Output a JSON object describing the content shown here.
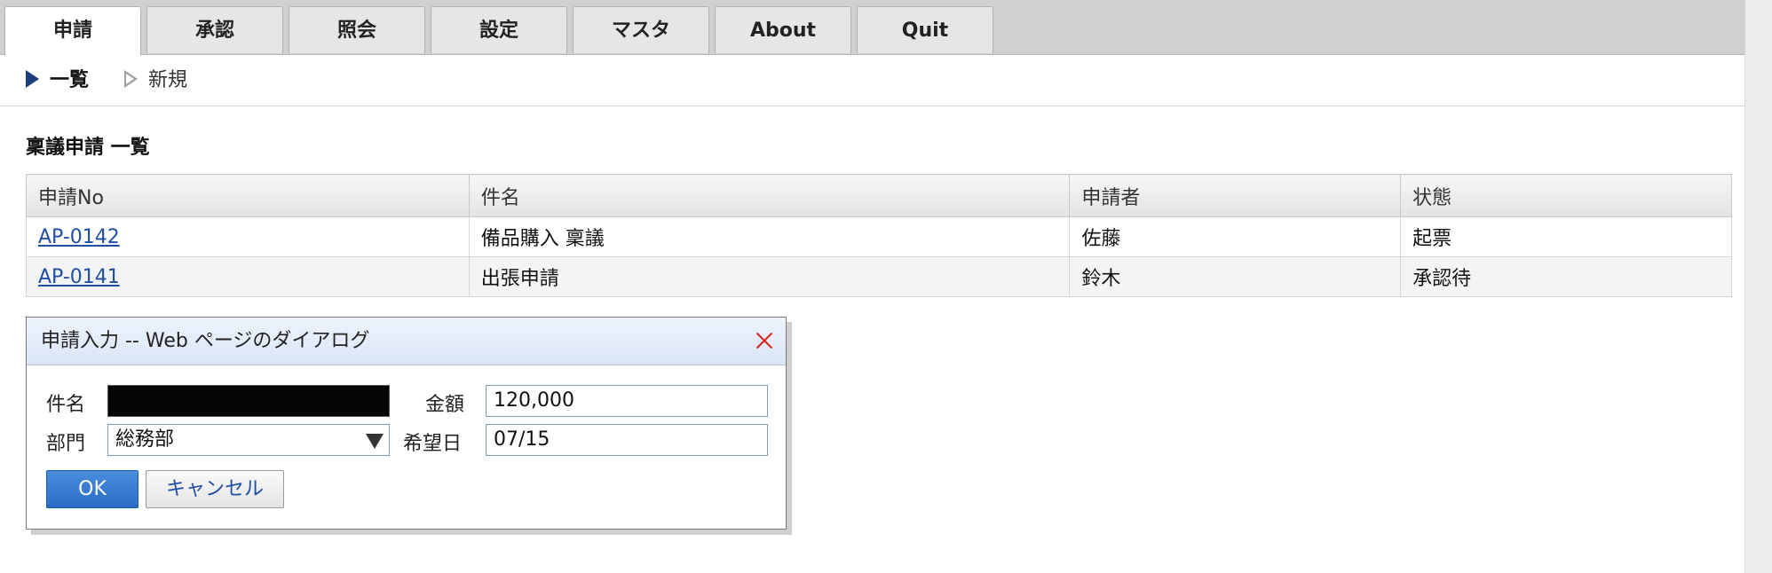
{
  "tabs": [
    "申請",
    "承認",
    "照会",
    "設定",
    "マスタ",
    "About",
    "Quit"
  ],
  "subnav": {
    "list_label": "一覧",
    "new_label": "新規"
  },
  "page_title": "稟議申請 一覧",
  "table": {
    "headers": [
      "申請No",
      "件名",
      "申請者",
      "状態"
    ],
    "rows": [
      {
        "no": "AP-0142",
        "subject": "備品購入 稟議",
        "applicant": "佐藤",
        "status": "起票"
      },
      {
        "no": "AP-0141",
        "subject": "出張申請",
        "applicant": "鈴木",
        "status": "承認待"
      }
    ]
  },
  "dialog": {
    "title": "申請入力 -- Web ページのダイアログ",
    "subject_label": "件名",
    "subject_value": "",
    "amount_label": "金額",
    "amount_value": "120,000",
    "dept_label": "部門",
    "dept_value": "総務部",
    "date_label": "希望日",
    "date_value": "07/15",
    "ok_label": "OK",
    "cancel_label": "キャンセル"
  },
  "colors": {
    "link": "#1f4ea3",
    "ok_button": "#2a6cc4",
    "close_icon": "#d9221c",
    "active_marker": "#1c3f7c"
  }
}
